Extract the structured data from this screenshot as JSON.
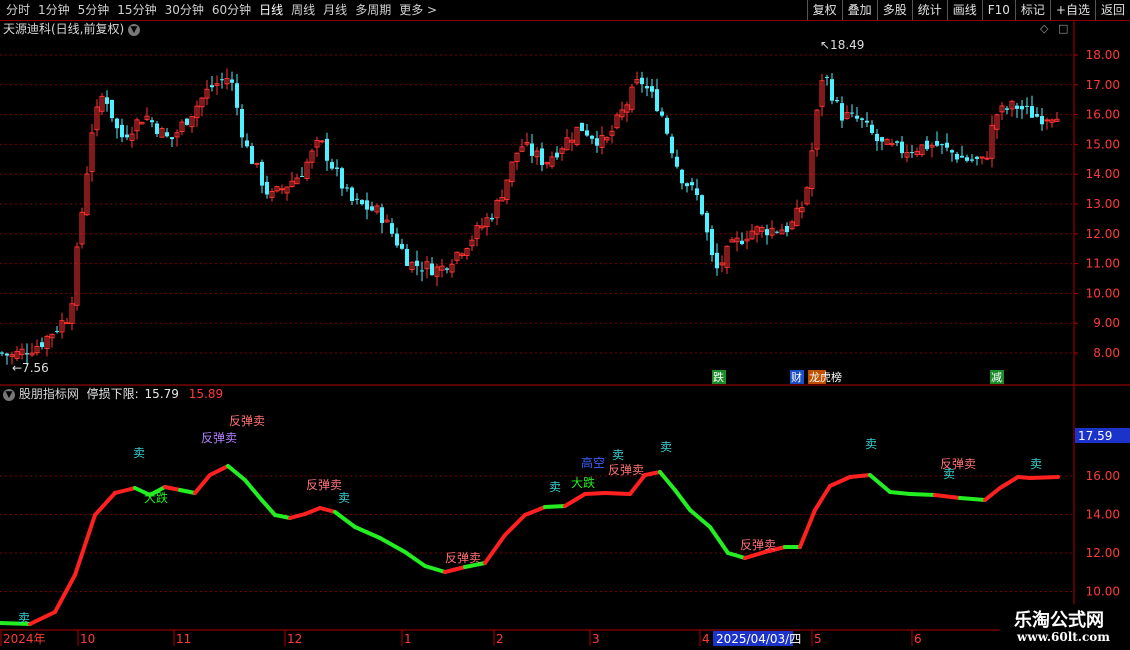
{
  "toolbar": {
    "periods": [
      "分时",
      "1分钟",
      "5分钟",
      "15分钟",
      "30分钟",
      "60分钟",
      "日线",
      "周线",
      "月线",
      "多周期",
      "更多 >"
    ],
    "active_period": "日线",
    "buttons": [
      "复权",
      "叠加",
      "多股",
      "统计",
      "画线",
      "F10",
      "标记",
      "+自选",
      "返回"
    ]
  },
  "main_chart": {
    "title": "天源迪科(日线,前复权)",
    "price_axis": [
      "18.00",
      "17.00",
      "16.00",
      "15.00",
      "14.00",
      "13.00",
      "12.00",
      "11.00",
      "10.00",
      "9.00",
      "8.00"
    ],
    "high_label": "18.49",
    "low_label": "7.56",
    "event_markers": [
      "跌",
      "财",
      "龙虎榜",
      "减"
    ],
    "colors": {
      "up": "#ff3232",
      "down": "#4ff0ff"
    }
  },
  "indicator": {
    "name": "股朋指标网",
    "stop_label": "停损下限:",
    "stop_value1": "15.79",
    "stop_value2": "15.89",
    "axis": [
      "16.00",
      "14.00",
      "12.00",
      "10.00"
    ],
    "current_tag": "17.59",
    "signals": [
      "卖",
      "大跌",
      "反弹卖",
      "反弹卖",
      "卖",
      "反弹卖",
      "卖",
      "反弹卖",
      "卖",
      "大跌",
      "高空",
      "卖",
      "反弹卖",
      "卖",
      "反弹卖",
      "卖",
      "反弹卖",
      "卖",
      "卖"
    ],
    "colors": {
      "rise": "#ff2020",
      "fall": "#22ee22"
    }
  },
  "date_axis": {
    "labels": [
      "2024年",
      "10",
      "11",
      "12",
      "1",
      "2",
      "3",
      "4",
      "5",
      "6"
    ],
    "cursor_date": "2025/04/03/四"
  },
  "watermark": {
    "name": "乐淘公式网",
    "url": "www.60lt.com"
  }
}
